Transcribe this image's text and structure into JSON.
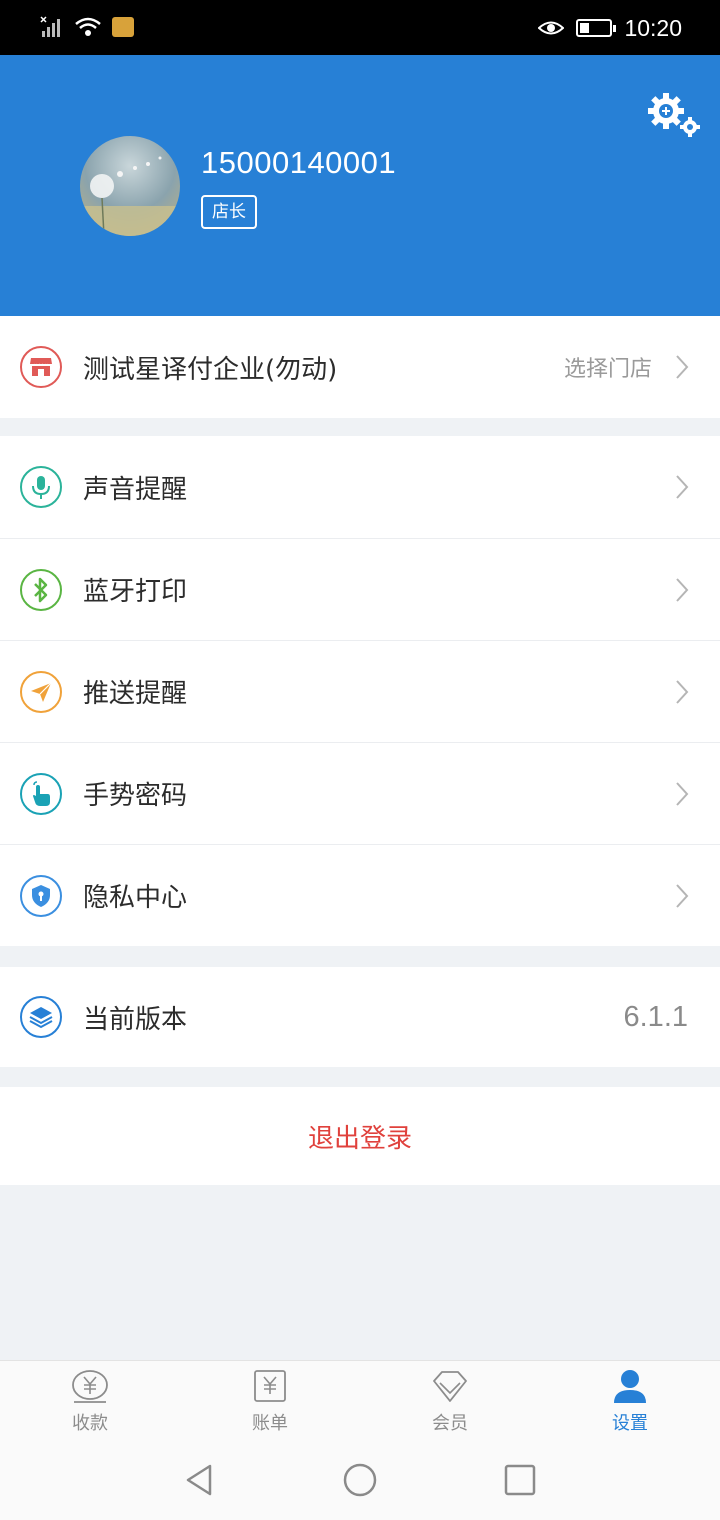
{
  "status_bar": {
    "time": "10:20",
    "icons": [
      "signal-icon",
      "wifi-icon",
      "sim-card-icon",
      "eye-icon",
      "battery-icon"
    ]
  },
  "profile": {
    "phone": "15000140001",
    "role": "店长",
    "settings_icon": "settings-gear-icon"
  },
  "store": {
    "name": "测试星译付企业(勿动)",
    "action_label": "选择门店",
    "icon": "store-icon",
    "color": "#e05a57"
  },
  "menu_items": [
    {
      "label": "声音提醒",
      "icon": "microphone-icon",
      "color": "#2bb39a"
    },
    {
      "label": "蓝牙打印",
      "icon": "bluetooth-icon",
      "color": "#5ab543"
    },
    {
      "label": "推送提醒",
      "icon": "paper-plane-icon",
      "color": "#f0a23a"
    },
    {
      "label": "手势密码",
      "icon": "gesture-icon",
      "color": "#1aa2b5"
    },
    {
      "label": "隐私中心",
      "icon": "shield-icon",
      "color": "#3b8fe0"
    }
  ],
  "version": {
    "label": "当前版本",
    "value": "6.1.1",
    "icon": "layers-icon",
    "color": "#2780d6"
  },
  "logout_label": "退出登录",
  "tabs": [
    {
      "label": "收款",
      "icon": "yen-coin-icon",
      "active": false
    },
    {
      "label": "账单",
      "icon": "bill-icon",
      "active": false
    },
    {
      "label": "会员",
      "icon": "diamond-icon",
      "active": false
    },
    {
      "label": "设置",
      "icon": "person-icon",
      "active": true
    }
  ],
  "theme": {
    "primary": "#2780d6",
    "danger": "#e0413c",
    "background": "#eff2f5"
  }
}
